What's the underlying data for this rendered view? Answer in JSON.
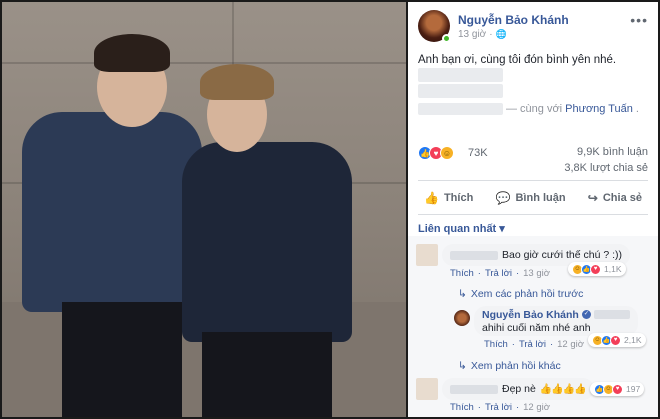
{
  "post": {
    "author": "Nguyễn Bảo Khánh",
    "time": "13 giờ",
    "text": "Anh bạn ơi, cùng tôi đón bình yên nhé.",
    "tag_prefix": "— cùng với",
    "tagged_friend": "Phương Tuấn",
    "tag_suffix": "."
  },
  "stats": {
    "reactions": "73K",
    "comments": "9,9K bình luận",
    "shares": "3,8K lượt chia sẻ"
  },
  "actions": {
    "like": "Thích",
    "comment": "Bình luận",
    "share": "Chia sẻ"
  },
  "sort_label": "Liên quan nhất",
  "comments": [
    {
      "text": "Bao giờ cưới thế chú ? :))",
      "like": "Thích",
      "reply": "Trả lời",
      "time": "13 giờ",
      "reactions": "1,1K"
    },
    {
      "view_previous": "Xem các phản hồi trước",
      "author": "Nguyễn Bảo Khánh",
      "text": "ahihi cuối năm nhé anh",
      "like": "Thích",
      "reply": "Trả lời",
      "time": "12 giờ",
      "reactions": "2,1K",
      "view_more": "Xem phản hồi khác"
    },
    {
      "text": "Đẹp nè",
      "emojis": "👍👍👍👍",
      "like": "Thích",
      "reply": "Trả lời",
      "time": "12 giờ",
      "reactions": "197"
    }
  ],
  "icons": {
    "more": "ellipsis-icon",
    "globe": "globe-icon",
    "like": "thumbs-up-icon",
    "comment": "speech-bubble-icon",
    "share": "share-arrow-icon",
    "reply_arrow": "reply-arrow-icon"
  },
  "colors": {
    "link": "#385898",
    "like_blue": "#2078f4",
    "love_red": "#f33e58",
    "haha_yellow": "#f7b125"
  }
}
